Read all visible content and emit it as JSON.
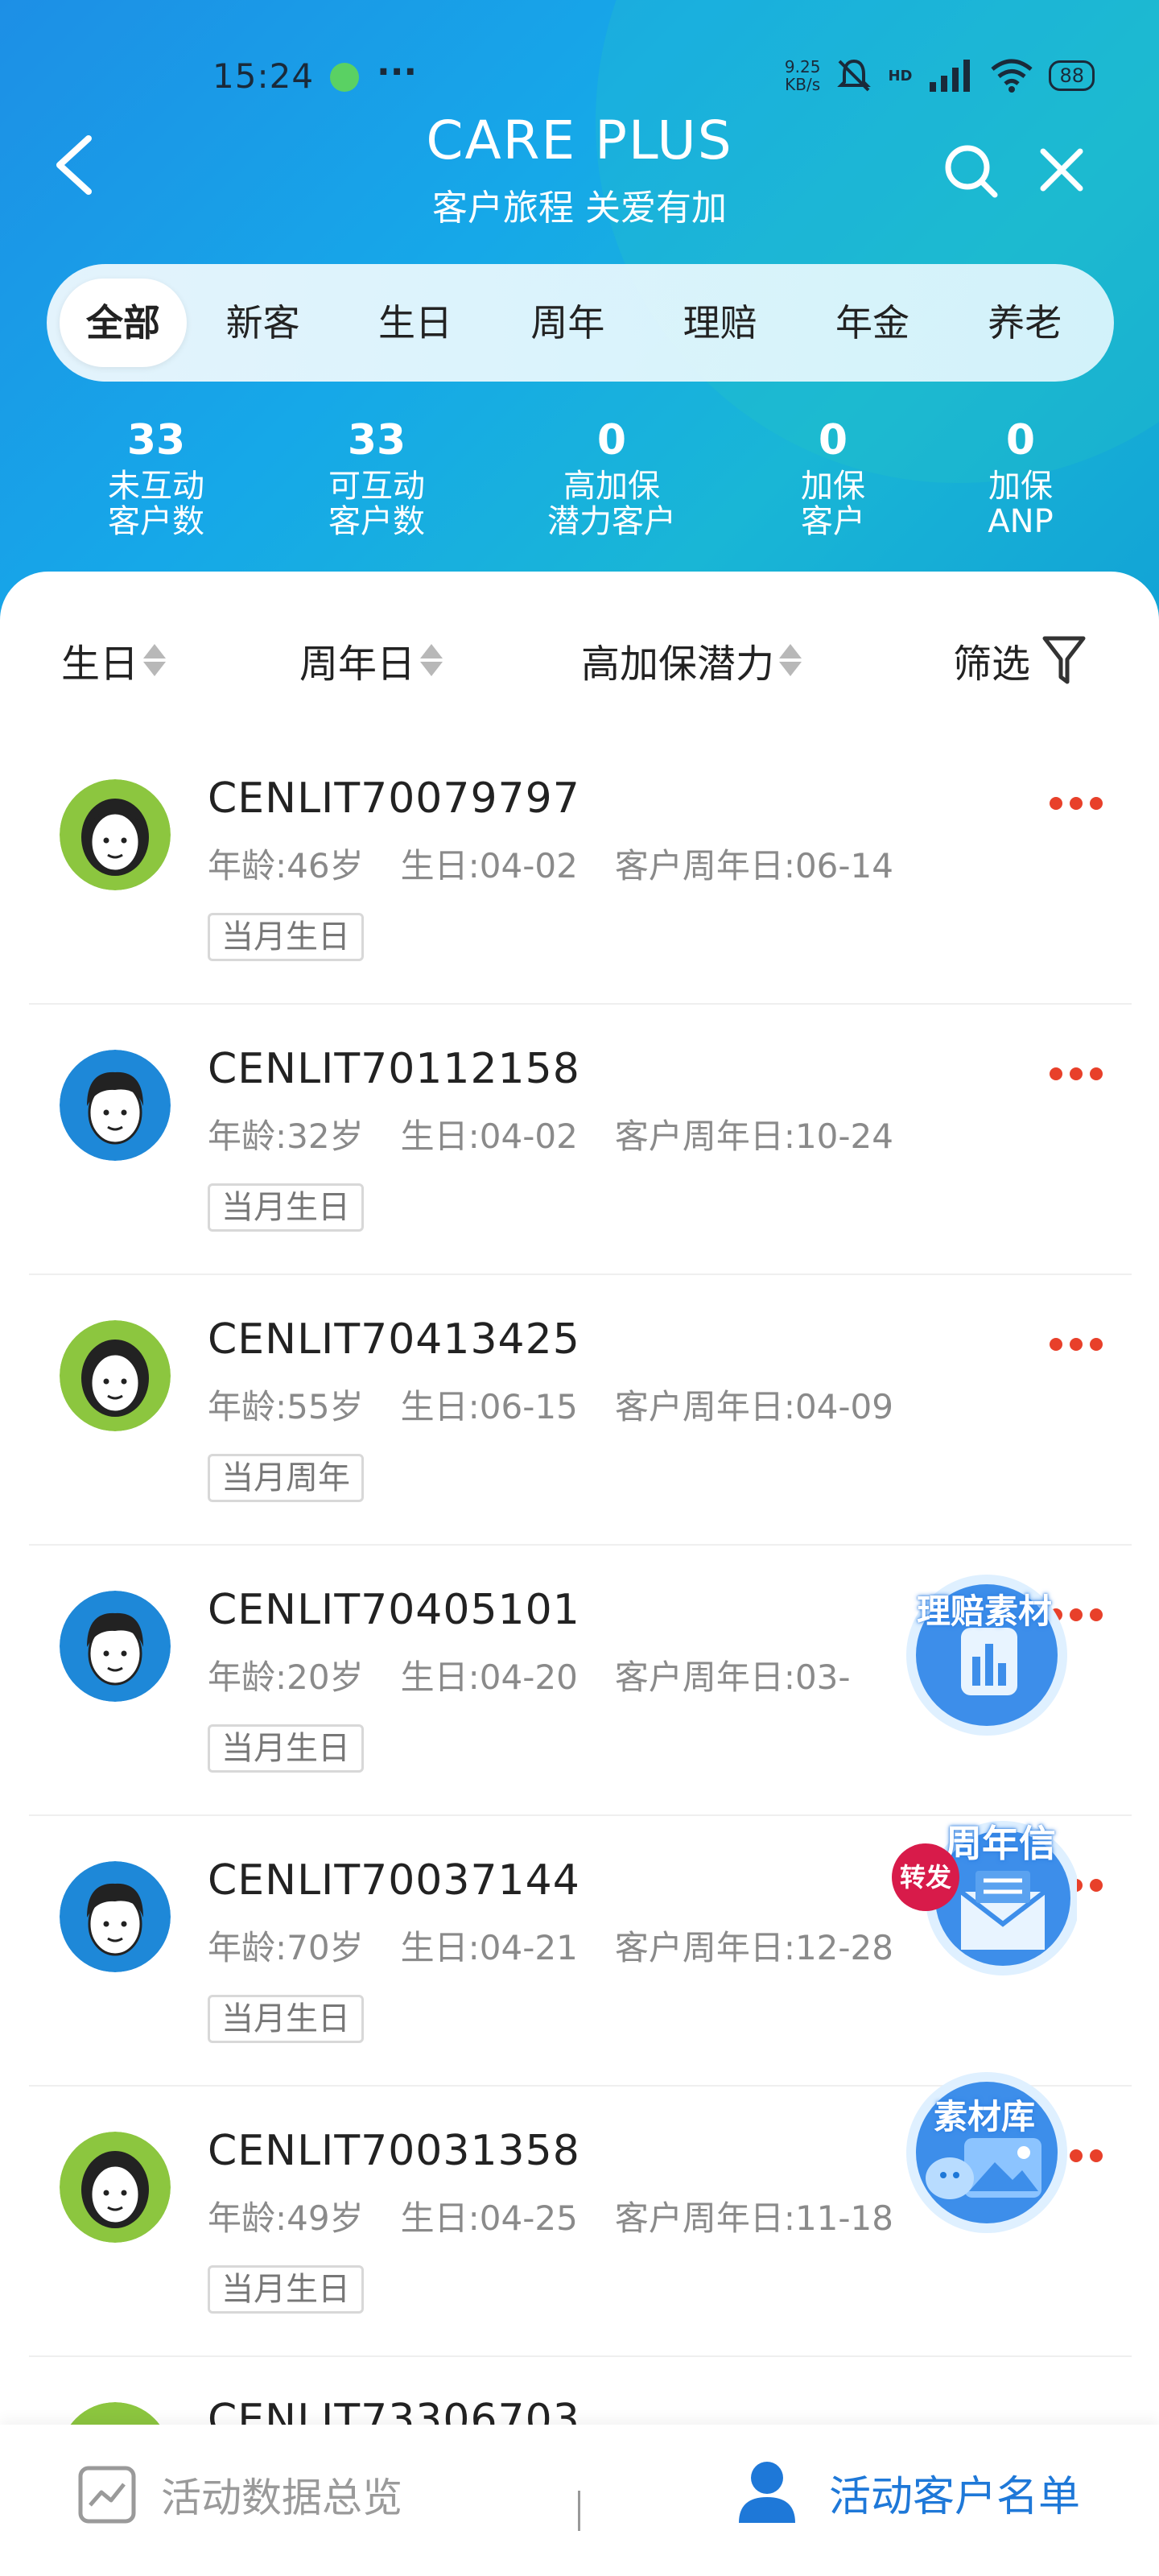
{
  "status": {
    "time": "15:24",
    "speed_value": "9.25",
    "speed_unit": "KB/s",
    "network_tag": "HD",
    "battery": "88"
  },
  "header": {
    "title": "CARE PLUS",
    "subtitle": "客户旅程 关爱有加"
  },
  "tabs": [
    {
      "label": "全部",
      "active": true
    },
    {
      "label": "新客",
      "active": false
    },
    {
      "label": "生日",
      "active": false
    },
    {
      "label": "周年",
      "active": false
    },
    {
      "label": "理赔",
      "active": false
    },
    {
      "label": "年金",
      "active": false
    },
    {
      "label": "养老",
      "active": false
    }
  ],
  "stats": [
    {
      "value": "33",
      "label_line1": "未互动",
      "label_line2": "客户数"
    },
    {
      "value": "33",
      "label_line1": "可互动",
      "label_line2": "客户数"
    },
    {
      "value": "0",
      "label_line1": "高加保",
      "label_line2": "潜力客户"
    },
    {
      "value": "0",
      "label_line1": "加保",
      "label_line2": "客户"
    },
    {
      "value": "0",
      "label_line1": "加保",
      "label_line2": "ANP"
    }
  ],
  "sort_bar": {
    "birthday": "生日",
    "anniversary": "周年日",
    "potential": "高加保潜力",
    "filter": "筛选"
  },
  "customers": [
    {
      "id": "CENLIT70079797",
      "age": "年龄:46岁",
      "birthday": "生日:04-02",
      "anniversary": "客户周年日:06-14",
      "tag": "当月生日",
      "avatar": "female"
    },
    {
      "id": "CENLIT70112158",
      "age": "年龄:32岁",
      "birthday": "生日:04-02",
      "anniversary": "客户周年日:10-24",
      "tag": "当月生日",
      "avatar": "male"
    },
    {
      "id": "CENLIT70413425",
      "age": "年龄:55岁",
      "birthday": "生日:06-15",
      "anniversary": "客户周年日:04-09",
      "tag": "当月周年",
      "avatar": "female"
    },
    {
      "id": "CENLIT70405101",
      "age": "年龄:20岁",
      "birthday": "生日:04-20",
      "anniversary": "客户周年日:03-",
      "tag": "当月生日",
      "avatar": "male"
    },
    {
      "id": "CENLIT70037144",
      "age": "年龄:70岁",
      "birthday": "生日:04-21",
      "anniversary": "客户周年日:12-28",
      "tag": "当月生日",
      "avatar": "male"
    },
    {
      "id": "CENLIT70031358",
      "age": "年龄:49岁",
      "birthday": "生日:04-25",
      "anniversary": "客户周年日:11-18",
      "tag": "当月生日",
      "avatar": "female"
    }
  ],
  "partial_row_id": "CENLIT73306703",
  "floating": {
    "claims_material": "理赔素材",
    "anniversary_letter": "周年信",
    "forward_badge": "转发",
    "material_library": "素材库"
  },
  "bottom_nav": {
    "overview": "活动数据总览",
    "customer_list": "活动客户名单"
  },
  "colors": {
    "primary_blue": "#1e78d8",
    "header_gradient_start": "#1d8fe6",
    "header_gradient_end": "#19b6d6",
    "more_dots_red": "#e8402a",
    "avatar_female_bg": "#8cc63f",
    "avatar_male_bg": "#1e88d8"
  },
  "icons": {
    "back": "back-arrow-icon",
    "search": "search-icon",
    "close": "close-icon",
    "filter": "filter-funnel-icon",
    "overview": "trend-chart-icon",
    "customer_list": "person-icon",
    "more": "more-dots-icon"
  }
}
